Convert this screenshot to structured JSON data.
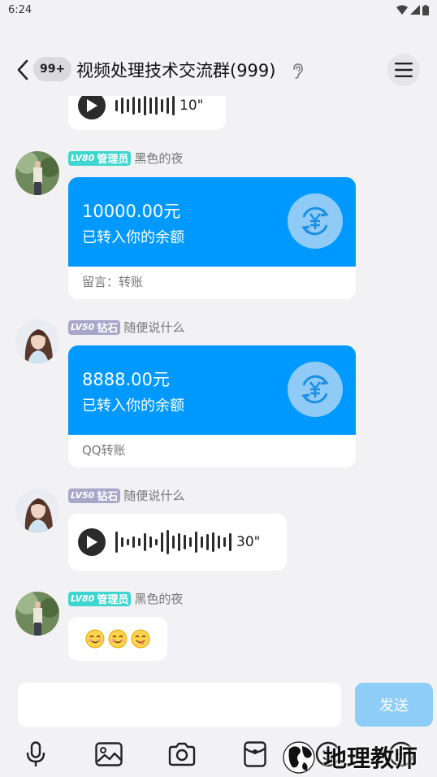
{
  "status_bar": {
    "time": "6:24"
  },
  "header": {
    "unread_badge": "99+",
    "title": "视频处理技术交流群(999)"
  },
  "messages": [
    {
      "type": "voice",
      "duration": "10\""
    },
    {
      "type": "transfer",
      "level": "LV80",
      "role": "管理员",
      "sender": "黑色的夜",
      "amount": "10000.00元",
      "status": "已转入你的余额",
      "note": "留言：转账"
    },
    {
      "type": "transfer",
      "level": "LV50",
      "role": "钻石",
      "sender": "随便说什么",
      "amount": "8888.00元",
      "status": "已转入你的余额",
      "note": "QQ转账"
    },
    {
      "type": "voice",
      "level": "LV50",
      "role": "钻石",
      "sender": "随便说什么",
      "duration": "30\""
    },
    {
      "type": "emoji",
      "level": "LV80",
      "role": "管理员",
      "sender": "黑色的夜",
      "emojis": [
        "😊",
        "😊",
        "😋"
      ]
    }
  ],
  "composer": {
    "input_value": "",
    "send_label": "发送"
  },
  "toolbar": {
    "icons": [
      "microphone-icon",
      "image-icon",
      "camera-icon",
      "red-packet-icon",
      "emoji-icon",
      "plus-icon"
    ]
  },
  "watermark": {
    "text": "地理教师"
  },
  "colors": {
    "transfer_blue": "#0099ff",
    "send_button": "#8ecdf8",
    "admin_badge": "#3fd6d0",
    "diamond_badge": "#a9a7c9"
  }
}
